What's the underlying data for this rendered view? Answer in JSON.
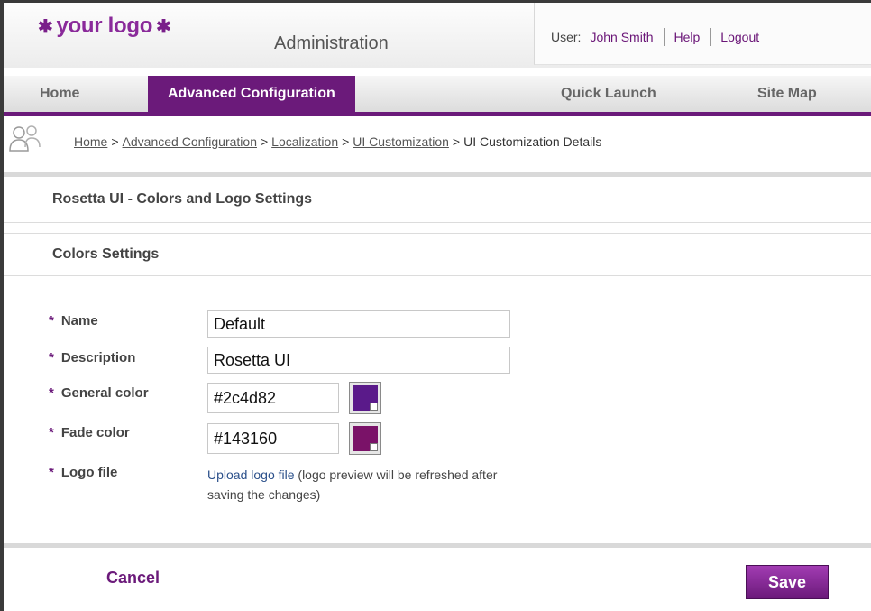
{
  "header": {
    "logo_text": "your logo",
    "app_title": "Administration",
    "user_label": "User:",
    "user_name": "John Smith",
    "help": "Help",
    "logout": "Logout"
  },
  "tabs": [
    {
      "label": "Home"
    },
    {
      "label": "Advanced Configuration"
    },
    {
      "label": "Quick Launch"
    },
    {
      "label": "Site Map"
    }
  ],
  "breadcrumb": [
    {
      "label": "Home"
    },
    {
      "label": "Advanced Configuration"
    },
    {
      "label": "Localization"
    },
    {
      "label": "UI Customization"
    },
    {
      "label": "UI Customization Details"
    }
  ],
  "breadcrumb_separator": ">",
  "page_title": "Rosetta UI - Colors and Logo Settings",
  "section_title": "Colors Settings",
  "form": {
    "required_marker": "*",
    "name_label": "Name",
    "name_value": "Default",
    "description_label": "Description",
    "description_value": "Rosetta UI",
    "general_color_label": "General color",
    "general_color_value": "#2c4d82",
    "fade_color_label": "Fade color",
    "fade_color_value": "#143160",
    "logo_file_label": "Logo file",
    "upload_link": "Upload logo file",
    "upload_note": " (logo preview will be refreshed after saving the changes)"
  },
  "actions": {
    "cancel": "Cancel",
    "save": "Save"
  },
  "colors": {
    "accent": "#6b1a7a",
    "general_swatch": "#5a1a8a",
    "fade_swatch": "#7a1268"
  }
}
